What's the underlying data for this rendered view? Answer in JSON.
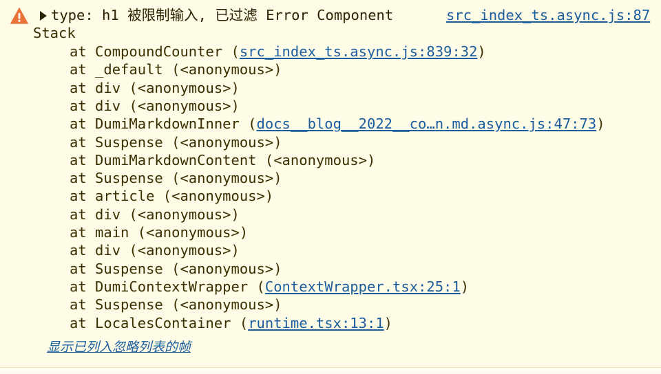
{
  "warning": {
    "icon": "warning-icon",
    "icon_color": "#e8743b",
    "message": "type: h1 被限制输入, 已过滤 Error Component",
    "source": "src_index_ts.async.js:87",
    "stack_label": "Stack",
    "frames": [
      {
        "prefix": "at CompoundCounter (",
        "link": "src_index_ts.async.js:839:32",
        "suffix": ")"
      },
      {
        "prefix": "at _default (<anonymous>)",
        "link": "",
        "suffix": ""
      },
      {
        "prefix": "at div (<anonymous>)",
        "link": "",
        "suffix": ""
      },
      {
        "prefix": "at div (<anonymous>)",
        "link": "",
        "suffix": ""
      },
      {
        "prefix": "at DumiMarkdownInner (",
        "link": "docs__blog__2022__co…n.md.async.js:47:73",
        "suffix": ")"
      },
      {
        "prefix": "at Suspense (<anonymous>)",
        "link": "",
        "suffix": ""
      },
      {
        "prefix": "at DumiMarkdownContent (<anonymous>)",
        "link": "",
        "suffix": ""
      },
      {
        "prefix": "at Suspense (<anonymous>)",
        "link": "",
        "suffix": ""
      },
      {
        "prefix": "at article (<anonymous>)",
        "link": "",
        "suffix": ""
      },
      {
        "prefix": "at div (<anonymous>)",
        "link": "",
        "suffix": ""
      },
      {
        "prefix": "at main (<anonymous>)",
        "link": "",
        "suffix": ""
      },
      {
        "prefix": "at div (<anonymous>)",
        "link": "",
        "suffix": ""
      },
      {
        "prefix": "at Suspense (<anonymous>)",
        "link": "",
        "suffix": ""
      },
      {
        "prefix": "at DumiContextWrapper (",
        "link": "ContextWrapper.tsx:25:1",
        "suffix": ")"
      },
      {
        "prefix": "at Suspense (<anonymous>)",
        "link": "",
        "suffix": ""
      },
      {
        "prefix": "at LocalesContainer (",
        "link": "runtime.tsx:13:1",
        "suffix": ")"
      }
    ],
    "show_ignored_label": "显示已列入忽略列表的帧"
  },
  "colors": {
    "background": "#fefbe6",
    "text": "#3b2f00",
    "link": "#1a5d9e"
  }
}
